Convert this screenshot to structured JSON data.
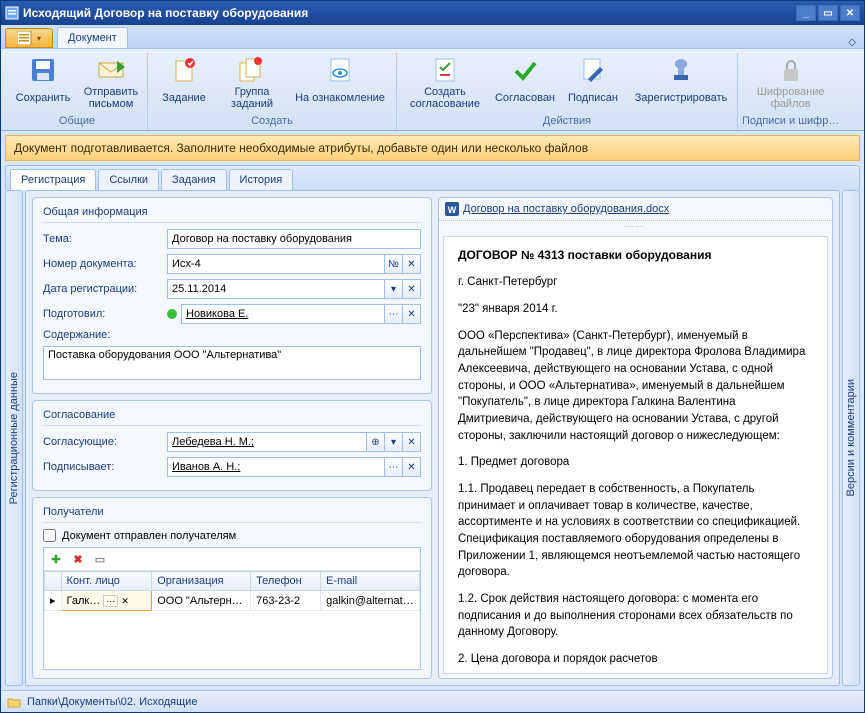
{
  "title": "Исходящий Договор на поставку оборудования",
  "ribbon_tab": "Документ",
  "ribbon": {
    "groups": {
      "common": {
        "title": "Общие",
        "save": "Сохранить",
        "send": "Отправить письмом"
      },
      "create": {
        "title": "Создать",
        "task": "Задание",
        "taskgroup": "Группа заданий",
        "review": "На ознакомление"
      },
      "actions": {
        "title": "Действия",
        "approval": "Создать согласование",
        "approved": "Согласован",
        "signed": "Подписан",
        "register": "Зарегистрировать"
      },
      "sign": {
        "title": "Подписи и шифр…",
        "encrypt": "Шифрование файлов"
      }
    }
  },
  "infobar": "Документ подготавливается. Заполните необходимые атрибуты, добавьте один или несколько файлов",
  "side_left": "Регистрационные данные",
  "side_right": "Версии и комментарии",
  "tabs": {
    "reg": "Регистрация",
    "links": "Ссылки",
    "tasks": "Задания",
    "history": "История"
  },
  "panel_general": {
    "title": "Общая информация",
    "theme_lbl": "Тема:",
    "theme": "Договор на поставку оборудования",
    "num_lbl": "Номер документа:",
    "num": "Исх-4",
    "num_btn": "№",
    "date_lbl": "Дата регистрации:",
    "date": "25.11.2014",
    "author_lbl": "Подготовил:",
    "author": "Новикова Е.",
    "content_lbl": "Содержание:",
    "content": "Поставка оборудования ООО \"Альтернатива\""
  },
  "panel_approval": {
    "title": "Согласование",
    "approvers_lbl": "Согласующие:",
    "approvers": "Лебедева Н. М.;",
    "signer_lbl": "Подписывает:",
    "signer": "Иванов А. Н.;"
  },
  "panel_recipients": {
    "title": "Получатели",
    "sent_lbl": "Документ отправлен получателям",
    "cols": {
      "contact": "Конт. лицо",
      "org": "Организация",
      "phone": "Телефон",
      "email": "E-mail"
    },
    "row": {
      "contact": "Галк…",
      "org": "ООО \"Альтерн…",
      "phone": "763-23-2",
      "email": "galkin@alternativa.co"
    }
  },
  "file": "Договор на поставку оборудования.docx",
  "doc": {
    "h": "ДОГОВОР № 4313 поставки оборудования",
    "city": "г. Санкт-Петербург",
    "date": "\"23\" января 2014 г.",
    "p1": "ООО «Перспектива» (Санкт-Петербург), именуемый в дальнейшем \"Продавец\", в лице директора Фролова Владимира Алексеевича, действующего на основании Устава, с одной стороны, и ООО «Альтернатива», именуемый в дальнейшем \"Покупатель\", в лице директора Галкина Валентина Дмитриевича, действующего на основании Устава, с другой стороны, заключили настоящий договор о нижеследующем:",
    "s1": "1. Предмет договора",
    "p2": "1.1. Продавец передает в собственность, а Покупатель принимает и оплачивает товар в количестве, качестве, ассортименте и на условиях в соответствии со спецификацией. Спецификация поставляемого оборудования определены в Приложении 1, являющемся неотъемлемой частью настоящего договора.",
    "p3": "1.2. Срок действия настоящего договора: с момента его подписания и до выполнения сторонами всех обязательств по данному Договору.",
    "s2": "2. Цена договора и порядок расчетов"
  },
  "status": "Папки\\Документы\\02. Исходящие"
}
